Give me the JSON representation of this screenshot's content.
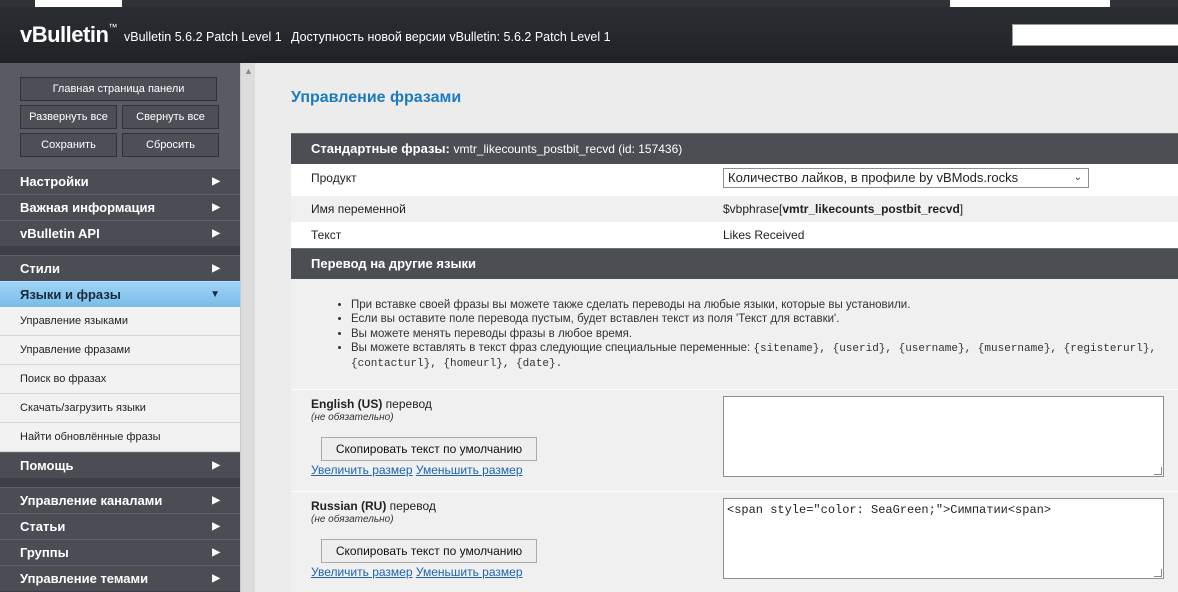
{
  "header": {
    "logo": "vBulletin",
    "logo_tm": "™",
    "version": "vBulletin 5.6.2 Patch Level 1",
    "update_notice": "Доступность новой версии vBulletin: 5.6.2 Patch Level 1",
    "search_placeholder": ""
  },
  "sidebar": {
    "buttons": {
      "home": "Главная страница панели",
      "expand_all": "Развернуть все",
      "collapse_all": "Свернуть все",
      "save": "Сохранить",
      "reset": "Сбросить"
    },
    "group1": [
      "Настройки",
      "Важная информация",
      "vBulletin API"
    ],
    "styles": "Стили",
    "languages": "Языки и фразы",
    "sub_items": [
      "Управление языками",
      "Управление фразами",
      "Поиск во фразах",
      "Скачать/загрузить языки",
      "Найти обновлённые фразы"
    ],
    "help": "Помощь",
    "group2": [
      "Управление каналами",
      "Статьи",
      "Группы",
      "Управление темами"
    ]
  },
  "main": {
    "title": "Управление фразами",
    "standard": {
      "heading": "Стандартные фразы:",
      "phrase_id": "vmtr_likecounts_postbit_recvd (id: 157436)",
      "product_label": "Продукт",
      "product_value": "Количество лайков, в профиле by vBMods.rocks",
      "varname_label": "Имя переменной",
      "varname_prefix": "$vbphrase[",
      "varname_name": "vmtr_likecounts_postbit_recvd",
      "varname_suffix": "]",
      "text_label": "Текст",
      "text_value": "Likes Received"
    },
    "translate": {
      "heading": "Перевод на другие языки",
      "bullets": [
        "При вставке своей фразы вы можете также сделать переводы на любые языки, которые вы установили.",
        "Если вы оставите поле перевода пустым, будет вставлен текст из поля 'Текст для вставки'.",
        "Вы можете менять переводы фразы в любое время."
      ],
      "bullet4_prefix": "Вы можете вставлять в текст фраз следующие специальные переменные:",
      "bullet4_vars_line1": "{sitename}, {userid}, {username}, {musername}, {registerurl},",
      "bullet4_vars_line2": "{contacturl}, {homeurl}, {date}."
    },
    "languages": [
      {
        "lang_bold": "English (US)",
        "lang_suffix": " перевод",
        "optional": "(не обязательно)",
        "copy_button": "Скопировать текст по умолчанию",
        "enlarge": "Увеличить размер",
        "shrink": "Уменьшить размер",
        "value": ""
      },
      {
        "lang_bold": "Russian (RU)",
        "lang_suffix": " перевод",
        "optional": "(не обязательно)",
        "copy_button": "Скопировать текст по умолчанию",
        "enlarge": "Увеличить размер",
        "shrink": "Уменьшить размер",
        "value": "<span style=\"color: SeaGreen;\">Симпатии<span>"
      }
    ]
  },
  "icons": {
    "chevron_right": "▶",
    "chevron_down": "▼",
    "scroll_up": "▲",
    "select_caret": "⌄"
  }
}
